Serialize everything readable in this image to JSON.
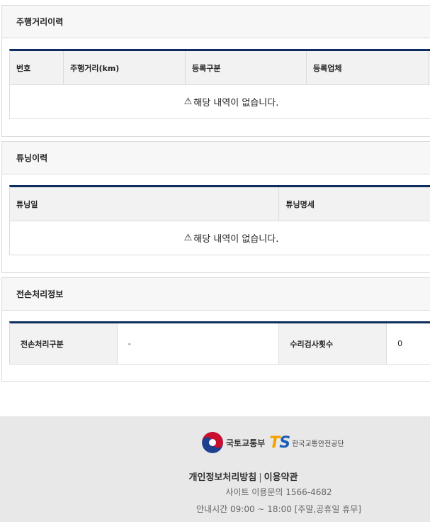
{
  "mileage": {
    "title": "주행거리이력",
    "columns": [
      "번호",
      "주행거리(km)",
      "등록구분",
      "등록업체"
    ],
    "empty_message": "해당 내역이 없습니다."
  },
  "tuning": {
    "title": "튜닝이력",
    "columns": [
      "튜닝일",
      "튜닝명세"
    ],
    "empty_message": "해당 내역이 없습니다."
  },
  "total_loss": {
    "title": "전손처리정보",
    "row": {
      "type_label": "전손처리구분",
      "type_value": "-",
      "repair_label": "수리검사횟수",
      "repair_value": "0"
    }
  },
  "footer": {
    "ministry": "국토교통부",
    "ts_logo": "TS",
    "agency": "한국교통안전공단",
    "privacy_link": "개인정보처리방침",
    "separator": "|",
    "terms_link": "이용약관",
    "inquiry": "사이트 이용문의 1566-4682",
    "hours": "안내시간 09:00 ~ 18:00 [주말,공휴일 휴무]"
  },
  "colors": {
    "table_top_border": "#0c2d5e",
    "header_bg": "#f2f2f2",
    "footer_bg": "#e8e8e8",
    "ts_blue": "#1a5db4",
    "ts_orange": "#f5a100"
  }
}
